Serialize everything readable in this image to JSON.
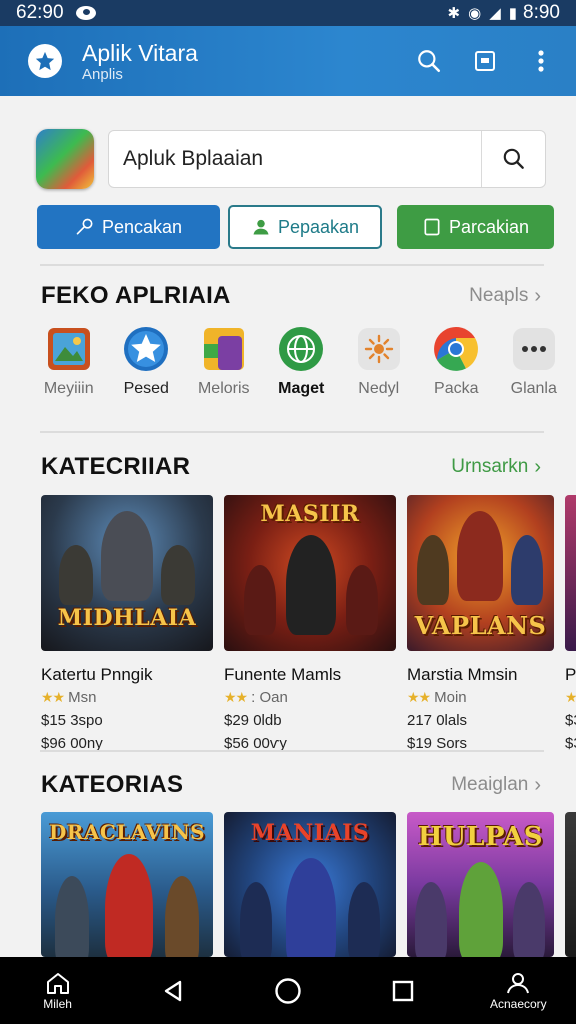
{
  "status_bar": {
    "time": "62:90",
    "clock_right": "8:90"
  },
  "app_bar": {
    "title": "Aplik Vitara",
    "subtitle": "Anplis",
    "icons": [
      "search-icon",
      "screen-icon",
      "more-vert-icon"
    ]
  },
  "search": {
    "placeholder": "Apluk Bplaaian"
  },
  "actions": [
    {
      "label": "Pencakan",
      "icon": "key-icon",
      "color": "#2274c2"
    },
    {
      "label": "Pepaakan",
      "icon": "person-icon",
      "color": "#1e7b88"
    },
    {
      "label": "Parcakian",
      "icon": "tablet-icon",
      "color": "#3e9c44"
    }
  ],
  "featured": {
    "title": "FEKO APLRIAIA",
    "link": "Neapls",
    "apps": [
      {
        "label": "Meyiiin",
        "icon": "photo-app-icon"
      },
      {
        "label": "Pesed",
        "icon": "star-app-icon"
      },
      {
        "label": "Meloris",
        "icon": "tools-app-icon"
      },
      {
        "label": "Maget",
        "icon": "globe-app-icon"
      },
      {
        "label": "Nedyl",
        "icon": "sun-app-icon"
      },
      {
        "label": "Packa",
        "icon": "chrome-app-icon"
      },
      {
        "label": "Glanla",
        "icon": "more-app-icon"
      }
    ]
  },
  "categories1": {
    "title": "KATECRIIAR",
    "link": "Urnsarkn",
    "cards": [
      {
        "cover_text": "MIDHLAIA",
        "title": "Katertu Pnngik",
        "rating": "Msn",
        "price1": "$15 3spo",
        "price2": "$96 00ny"
      },
      {
        "cover_text": "MASIIR",
        "title": "Funente Mamls",
        "rating": ": Oan",
        "price1": "$29 0ldb",
        "price2": "$56 00ѵy"
      },
      {
        "cover_text": "VAPLANS",
        "title": "Marstia Mmsin",
        "rating": "Moin",
        "price1": "217 0lals",
        "price2": "$19 Sors"
      },
      {
        "cover_text": "",
        "title": "Pla",
        "rating": "",
        "price1": "$3",
        "price2": "$3"
      }
    ]
  },
  "categories2": {
    "title": "KATEORIAS",
    "link": "Meaiglan",
    "cards": [
      {
        "cover_text": "DRACLAVINS"
      },
      {
        "cover_text": "MANIAIS"
      },
      {
        "cover_text": "HULPAS"
      },
      {
        "cover_text": ""
      }
    ]
  },
  "bottom_nav": [
    {
      "label": "Mileh",
      "icon": "home-icon"
    },
    {
      "label": "",
      "icon": "back-icon"
    },
    {
      "label": "",
      "icon": "home-circle-icon"
    },
    {
      "label": "",
      "icon": "recents-icon"
    },
    {
      "label": "Acnaecory",
      "icon": "account-icon"
    }
  ]
}
